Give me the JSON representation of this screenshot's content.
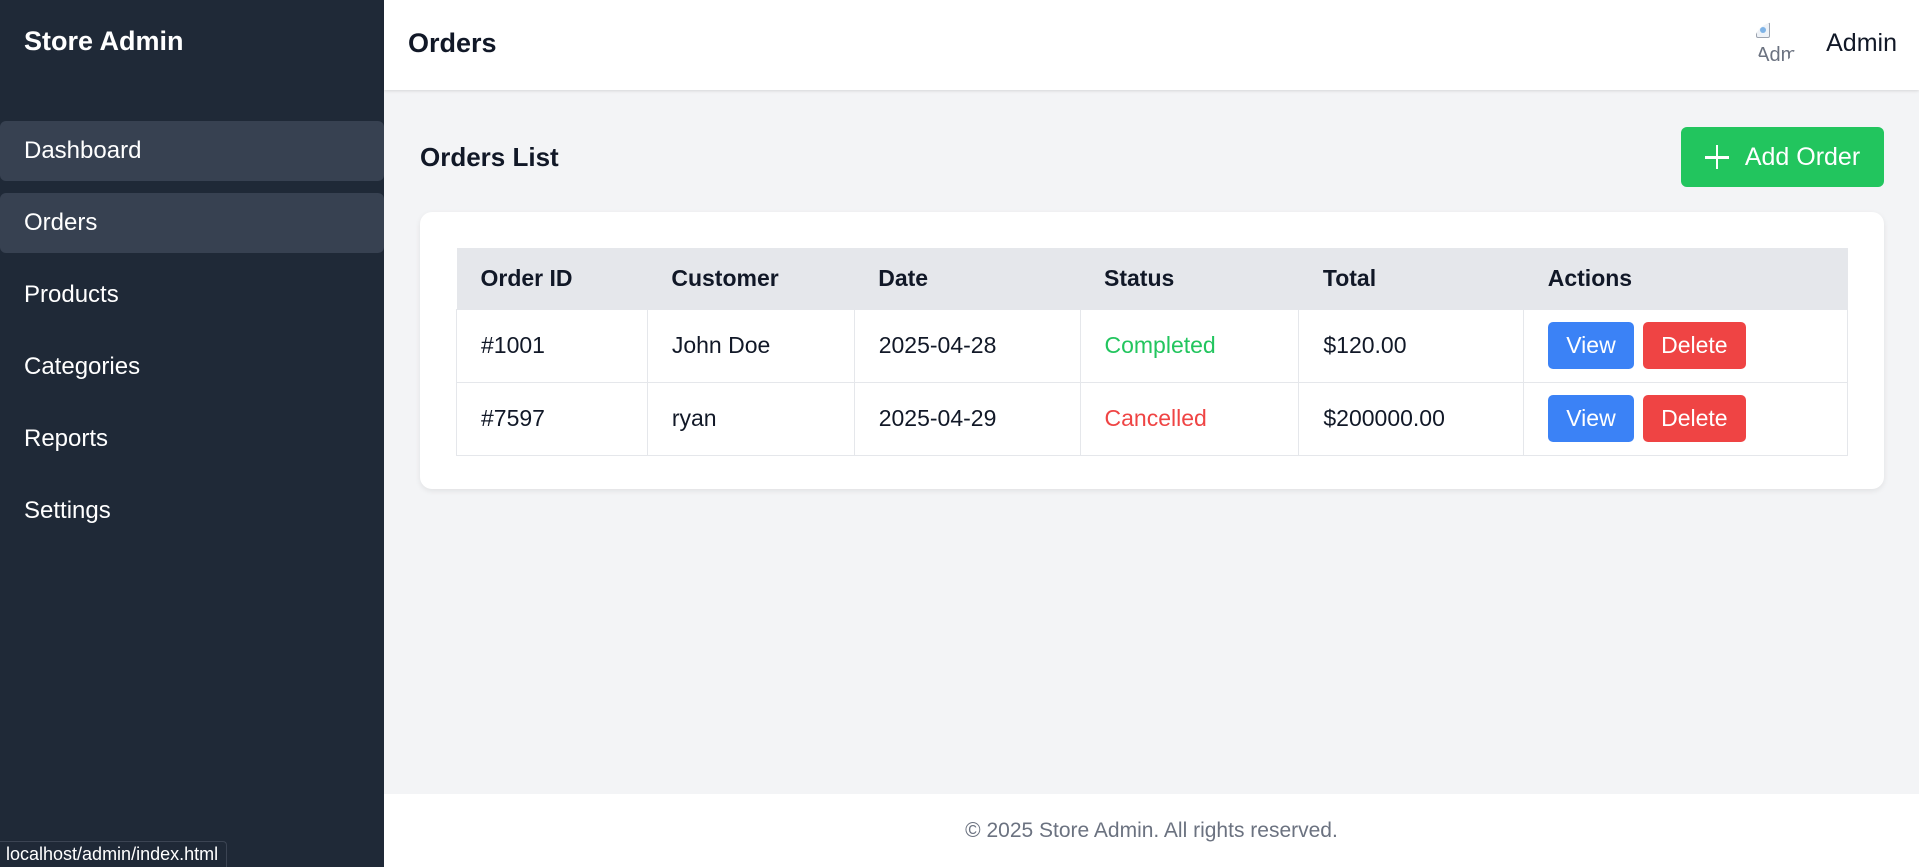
{
  "app": {
    "title": "Store Admin"
  },
  "sidebar": {
    "items": [
      {
        "label": "Dashboard"
      },
      {
        "label": "Orders"
      },
      {
        "label": "Products"
      },
      {
        "label": "Categories"
      },
      {
        "label": "Reports"
      },
      {
        "label": "Settings"
      }
    ]
  },
  "status_bar": {
    "url": "localhost/admin/index.html"
  },
  "header": {
    "title": "Orders",
    "avatar_alt": "Admin",
    "user_name": "Admin"
  },
  "orders": {
    "title": "Orders List",
    "add_label": "Add Order",
    "columns": [
      "Order ID",
      "Customer",
      "Date",
      "Status",
      "Total",
      "Actions"
    ],
    "rows": [
      {
        "id": "#1001",
        "customer": "John Doe",
        "date": "2025-04-28",
        "status": "Completed",
        "total": "$120.00",
        "view_label": "View",
        "delete_label": "Delete"
      },
      {
        "id": "#7597",
        "customer": "ryan",
        "date": "2025-04-29",
        "status": "Cancelled",
        "total": "$200000.00",
        "view_label": "View",
        "delete_label": "Delete"
      }
    ]
  },
  "footer": {
    "text": "© 2025 Store Admin. All rights reserved."
  },
  "colors": {
    "sidebar_bg": "#1f2937",
    "sidebar_active": "#374151",
    "add_button": "#22c55e",
    "view_button": "#3b82f6",
    "delete_button": "#ef4444",
    "status_completed": "#22c55e",
    "status_cancelled": "#ef4444"
  },
  "icons": {
    "add": "plus-icon",
    "avatar": "broken-image-icon"
  }
}
